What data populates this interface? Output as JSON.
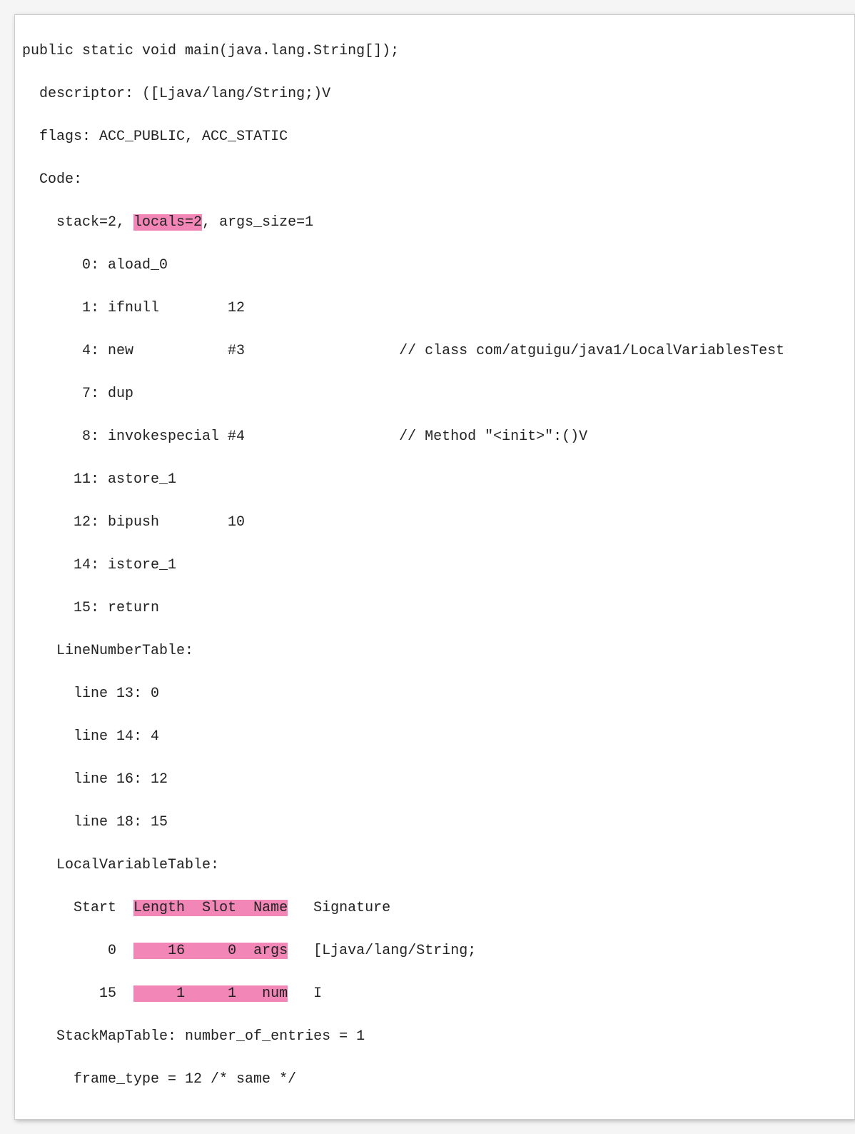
{
  "method": {
    "signature": "public static void main(java.lang.String[]);",
    "descriptor_label": "descriptor: ",
    "descriptor": "([Ljava/lang/String;)V",
    "flags_label": "flags: ",
    "flags": "ACC_PUBLIC, ACC_STATIC",
    "code_label": "Code:",
    "stack_prefix": "stack=2, ",
    "locals_hl": "locals=2",
    "args_suffix": ", args_size=1",
    "instructions": [
      "       0: aload_0",
      "       1: ifnull        12",
      "       4: new           #3                  // class com/atguigu/java1/LocalVariablesTest",
      "       7: dup",
      "       8: invokespecial #4                  // Method \"<init>\":()V",
      "      11: astore_1",
      "      12: bipush        10",
      "      14: istore_1",
      "      15: return"
    ],
    "lnt_label": "LineNumberTable:",
    "lnt": [
      "line 13: 0",
      "line 14: 4",
      "line 16: 12",
      "line 18: 15"
    ],
    "lvt_label": "LocalVariableTable:",
    "lvt_header": {
      "start": "Start",
      "length": "Length",
      "slot": "Slot",
      "name": "Name",
      "signature": "Signature"
    },
    "lvt_rows": [
      {
        "start": "0",
        "length": "16",
        "slot": "0",
        "name": "args",
        "sig": "[Ljava/lang/String;"
      },
      {
        "start": "15",
        "length": "1",
        "slot": "1",
        "name": "num",
        "sig": "I"
      }
    ],
    "smt": "StackMapTable: number_of_entries = 1",
    "smt_frame": "frame_type = 12 /* same */"
  }
}
